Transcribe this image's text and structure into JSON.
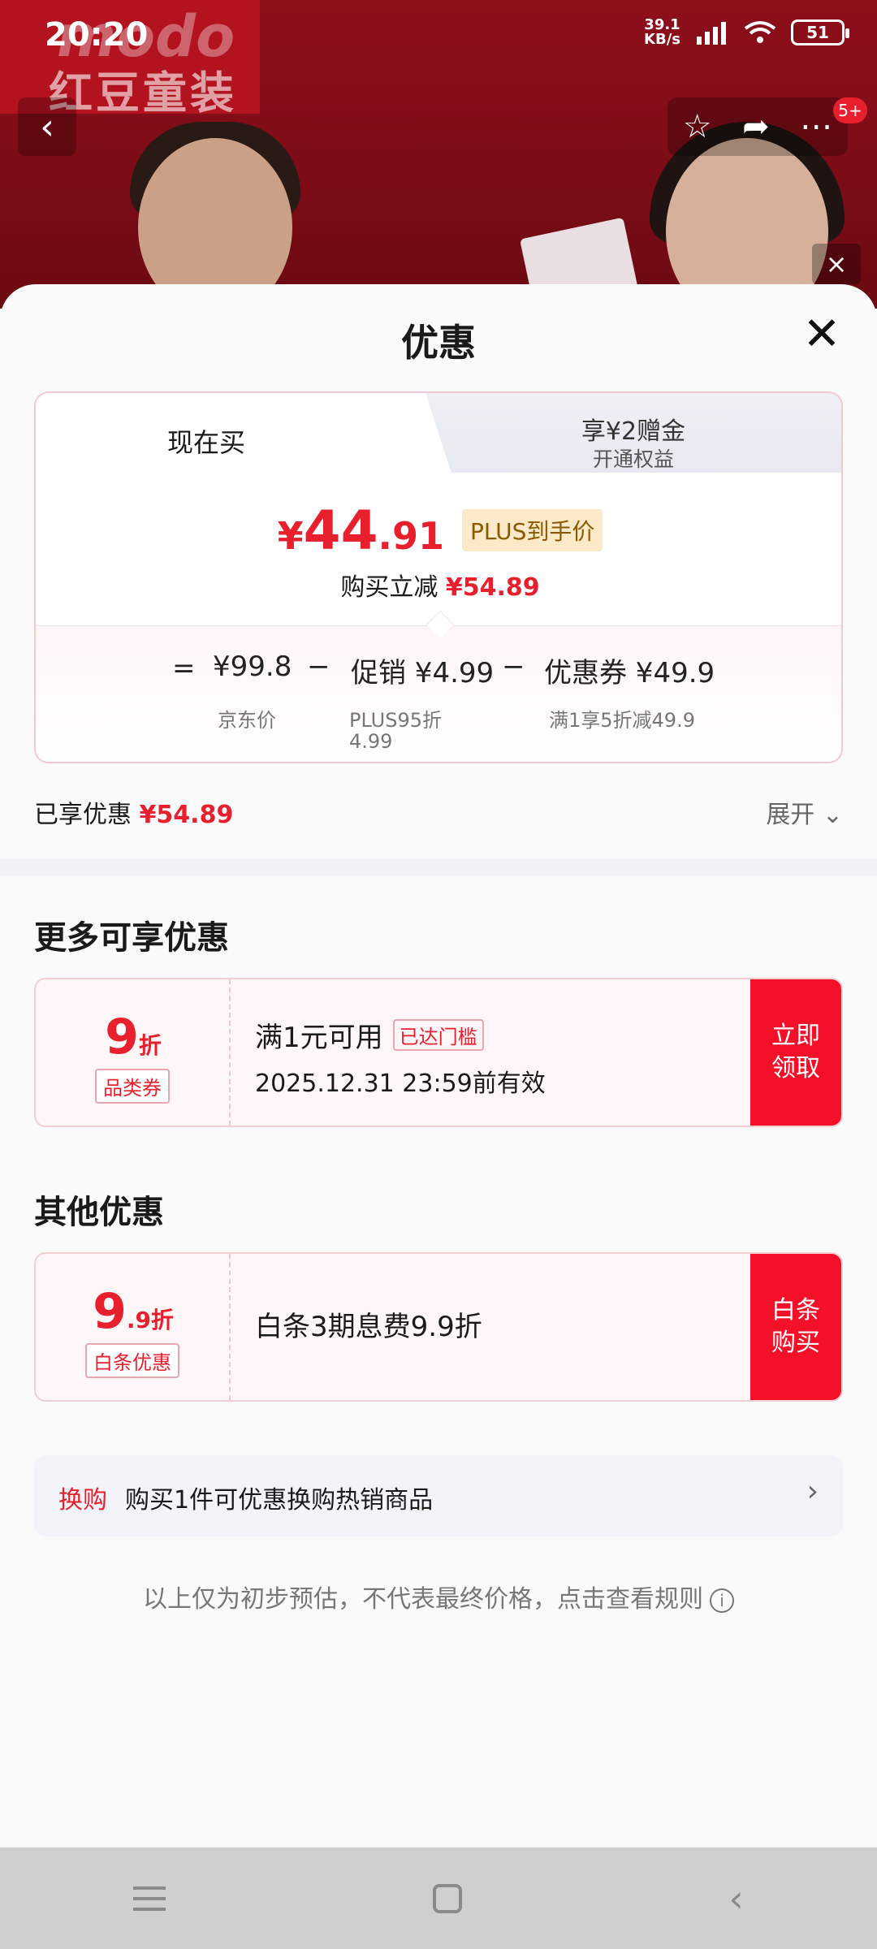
{
  "status": {
    "time": "20:20",
    "net_speed_value": "39.1",
    "net_speed_unit": "KB/s",
    "battery": "51"
  },
  "header_bg": {
    "brand_cn": "红豆童装",
    "brand_logo": "modo",
    "notify_badge": "5+"
  },
  "sheet": {
    "title": "优惠"
  },
  "tabs": {
    "now": "现在买",
    "plus_main": "享¥2赠金",
    "plus_sub": "开通权益"
  },
  "price": {
    "yen": "¥",
    "int": "44",
    "dec": ".91",
    "plus_tag": "PLUS到手价",
    "reduce_label": "购买立减",
    "reduce_value": "¥54.89"
  },
  "calc": {
    "eq": "=",
    "jd_price": "¥99.8",
    "jd_label": "京东价",
    "minus1": "−",
    "promo": "促销 ¥4.99",
    "promo_sub1": "PLUS95折",
    "promo_sub2": "4.99",
    "minus2": "−",
    "coupon": "优惠券 ¥49.9",
    "coupon_sub": "满1享5折减49.9"
  },
  "enjoyed": {
    "label": "已享优惠",
    "value": "¥54.89",
    "expand": "展开"
  },
  "more": {
    "title": "更多可享优惠",
    "coupon": {
      "big_num": "9",
      "big_unit": "折",
      "tag": "品类券",
      "line1": "满1元可用",
      "met_tag": "已达门槛",
      "line2": "2025.12.31 23:59前有效",
      "btn1": "立即",
      "btn2": "领取"
    }
  },
  "other": {
    "title": "其他优惠",
    "coupon": {
      "big_num": "9",
      "big_small": ".9折",
      "tag": "白条优惠",
      "line1": "白条3期息费9.9折",
      "btn1": "白条",
      "btn2": "购买"
    }
  },
  "swap": {
    "label": "换购",
    "text": "购买1件可优惠换购热销商品"
  },
  "note": "以上仅为初步预估，不代表最终价格，点击查看规则"
}
